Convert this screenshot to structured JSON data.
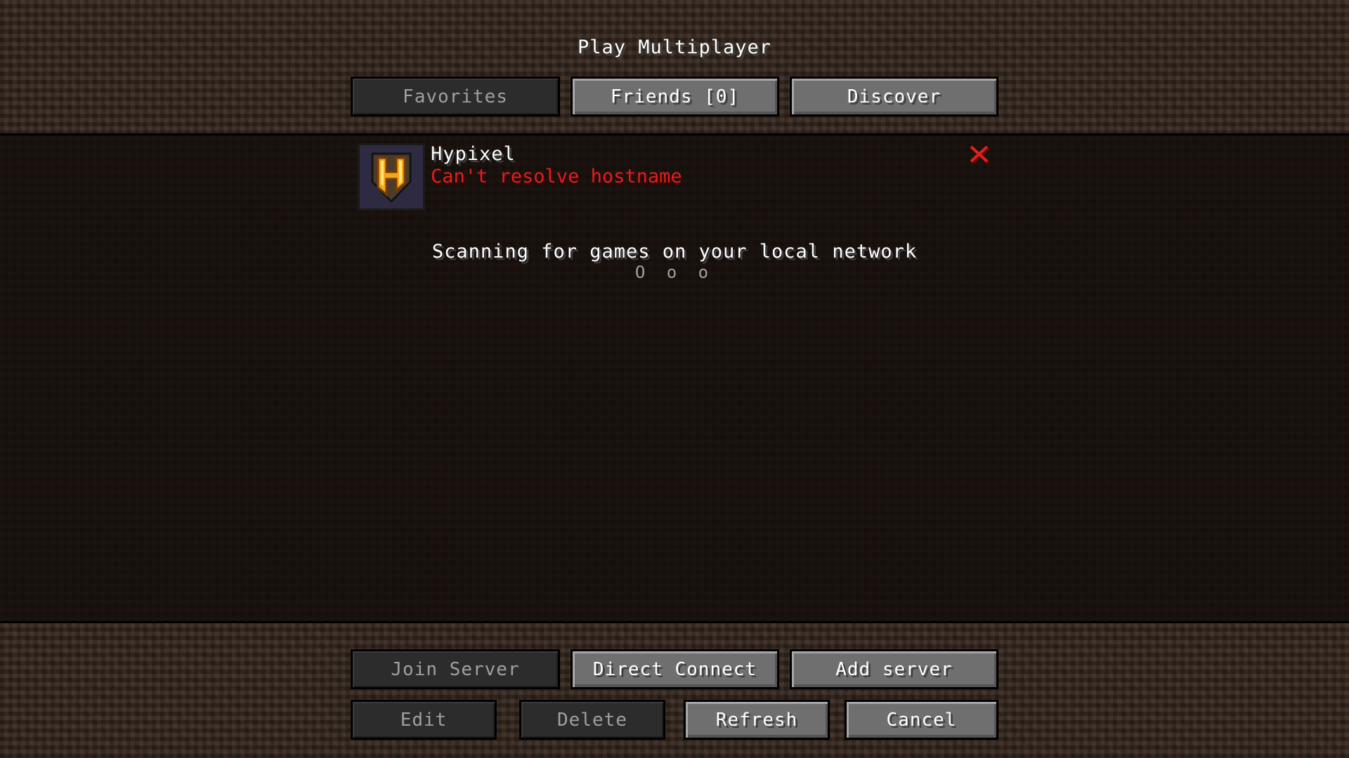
{
  "header": {
    "title": "Play Multiplayer"
  },
  "tabs": [
    {
      "label": "Favorites",
      "active": true
    },
    {
      "label": "Friends [0]",
      "active": false
    },
    {
      "label": "Discover",
      "active": false
    }
  ],
  "servers": [
    {
      "name": "Hypixel",
      "status": "Can't resolve hostname",
      "icon": "hypixel-h-shield-icon",
      "ping_icon": "red-x-icon"
    }
  ],
  "lan_scan": {
    "text": "Scanning for games on your local network",
    "dots": "O o o"
  },
  "actions_row1": {
    "join": "Join Server",
    "direct": "Direct Connect",
    "add": "Add server"
  },
  "actions_row2": {
    "edit": "Edit",
    "delete": "Delete",
    "refresh": "Refresh",
    "cancel": "Cancel"
  },
  "colors": {
    "error": "#e01f1f",
    "button": "#6f6f6f",
    "button_disabled": "#2c2c2c",
    "panel": "#120c09"
  }
}
